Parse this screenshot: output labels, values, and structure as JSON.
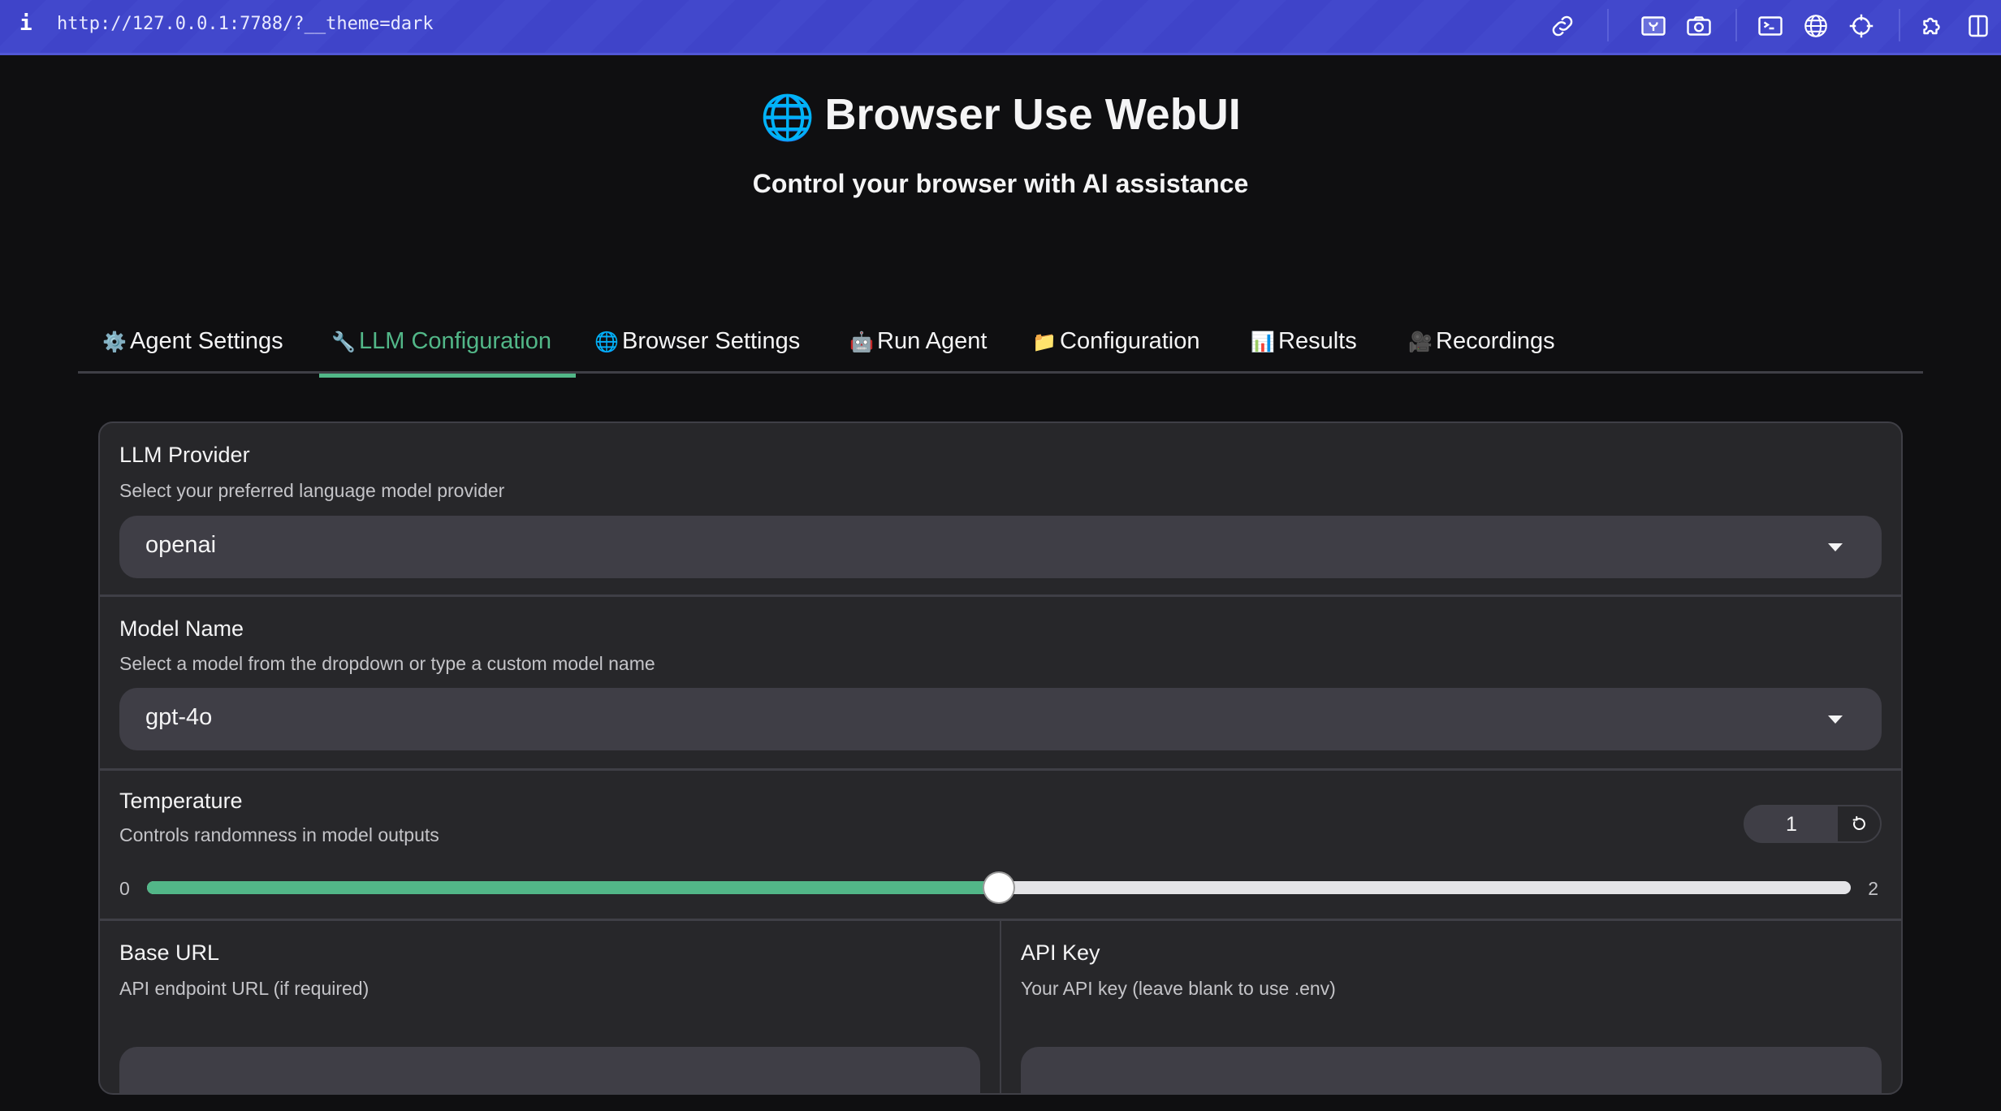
{
  "browser": {
    "url": "http://127.0.0.1:7788/?__theme=dark",
    "toolbar_icons": [
      "link-icon",
      "screenshot-region-icon",
      "camera-icon",
      "terminal-icon",
      "globe-icon",
      "crosshair-icon",
      "extension-icon",
      "split-view-icon"
    ]
  },
  "header": {
    "title_emoji": "🌐",
    "title": "Browser Use WebUI",
    "subtitle": "Control your browser with AI assistance"
  },
  "tabs": [
    {
      "emoji": "⚙️",
      "label": "Agent Settings",
      "active": false
    },
    {
      "emoji": "🔧",
      "label": "LLM Configuration",
      "active": true
    },
    {
      "emoji": "🌐",
      "label": "Browser Settings",
      "active": false
    },
    {
      "emoji": "🤖",
      "label": "Run Agent",
      "active": false
    },
    {
      "emoji": "📁",
      "label": "Configuration",
      "active": false
    },
    {
      "emoji": "📊",
      "label": "Results",
      "active": false
    },
    {
      "emoji": "🎥",
      "label": "Recordings",
      "active": false
    }
  ],
  "llm": {
    "provider": {
      "label": "LLM Provider",
      "description": "Select your preferred language model provider",
      "value": "openai"
    },
    "model": {
      "label": "Model Name",
      "description": "Select a model from the dropdown or type a custom model name",
      "value": "gpt-4o"
    },
    "temperature": {
      "label": "Temperature",
      "description": "Controls randomness in model outputs",
      "value": "1",
      "min": "0",
      "max": "2",
      "fraction": 0.5
    },
    "base_url": {
      "label": "Base URL",
      "description": "API endpoint URL (if required)",
      "value": ""
    },
    "api_key": {
      "label": "API Key",
      "description": "Your API key (leave blank to use .env)",
      "value": ""
    }
  },
  "colors": {
    "accent": "#52b788",
    "topbar": "#4046c8",
    "background": "#0f0f11",
    "panel": "#27272a",
    "input": "#3f3e46"
  }
}
